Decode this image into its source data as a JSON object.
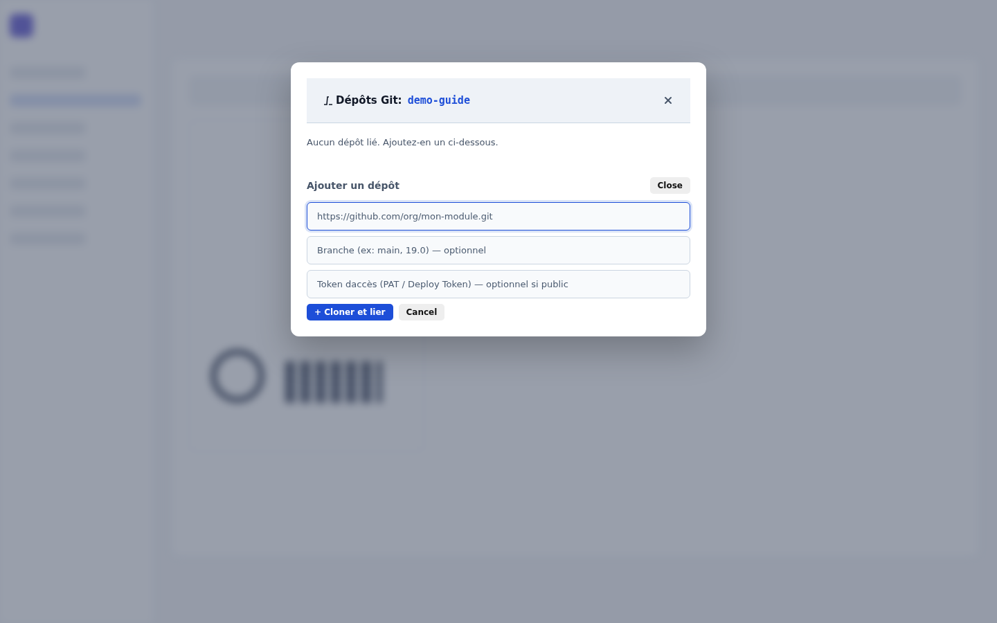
{
  "dialog": {
    "title": "Dépôts Git:",
    "repo": "demo-guide",
    "message": "Aucun dépôt lié. Ajoutez-en un ci-dessous.",
    "section_title": "Ajouter un dépôt",
    "section_close": "Close",
    "fields": [
      {
        "placeholder": "https://github.com/org/mon-module.git",
        "focused": true
      },
      {
        "placeholder": "Branche (ex: main, 19.0) — optionnel",
        "focused": false
      },
      {
        "placeholder": "Token daccès (PAT / Deploy Token) — optionnel si public",
        "focused": false
      }
    ],
    "buttons": [
      {
        "label": "+ Cloner et lier",
        "kind": "primary"
      },
      {
        "label": "Cancel",
        "kind": "secondary"
      }
    ]
  }
}
